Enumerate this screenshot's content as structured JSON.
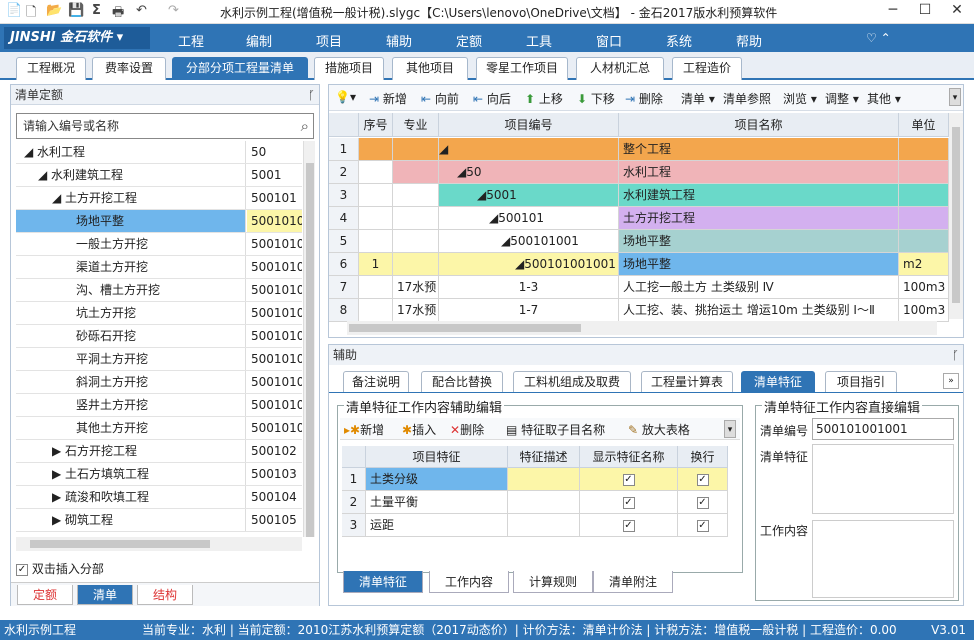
{
  "window": {
    "title": "水利示例工程(增值税一般计税).slygc【C:\\Users\\lenovo\\OneDrive\\文档】 - 金石2017版水利预算软件",
    "min": "─",
    "max": "☐",
    "close": "✕"
  },
  "menubar": {
    "logo": "JINSHI 金石软件 ▾",
    "items": [
      "工程",
      "编制",
      "项目",
      "辅助",
      "定额",
      "工具",
      "窗口",
      "系统",
      "帮助"
    ],
    "help_icon": "♡ ⌃"
  },
  "main_tabs": [
    "工程概况",
    "费率设置",
    "分部分项工程量清单",
    "措施项目",
    "其他项目",
    "零星工作项目",
    "人材机汇总",
    "工程造价"
  ],
  "left": {
    "header": "清单定额",
    "pin": "ᚵ",
    "search_placeholder": "请输入编号或名称",
    "tree": [
      {
        "name": "◢ 水利工程",
        "code": "50"
      },
      {
        "name": "◢ 水利建筑工程",
        "code": "5001"
      },
      {
        "name": "◢ 土方开挖工程",
        "code": "500101"
      },
      {
        "name": "场地平整",
        "code": "5001010"
      },
      {
        "name": "一般土方开挖",
        "code": "5001010"
      },
      {
        "name": "渠道土方开挖",
        "code": "5001010"
      },
      {
        "name": "沟、槽土方开挖",
        "code": "5001010"
      },
      {
        "name": "坑土方开挖",
        "code": "5001010"
      },
      {
        "name": "砂砾石开挖",
        "code": "5001010"
      },
      {
        "name": "平洞土方开挖",
        "code": "5001010"
      },
      {
        "name": "斜洞土方开挖",
        "code": "5001010"
      },
      {
        "name": "竖井土方开挖",
        "code": "5001010"
      },
      {
        "name": "其他土方开挖",
        "code": "5001010"
      },
      {
        "name": "▶ 石方开挖工程",
        "code": "500102"
      },
      {
        "name": "▶ 土石方填筑工程",
        "code": "500103"
      },
      {
        "name": "▶ 疏浚和吹填工程",
        "code": "500104"
      },
      {
        "name": "▶ 砌筑工程",
        "code": "500105"
      }
    ],
    "checkbox_label": "双击插入分部",
    "bottom_tabs": [
      "定额",
      "清单",
      "结构"
    ]
  },
  "toolbar": [
    "新增",
    "向前",
    "向后",
    "上移",
    "下移",
    "删除",
    "清单 ▾",
    "清单参照",
    "浏览 ▾",
    "调整 ▾",
    "其他 ▾"
  ],
  "grid": {
    "headers": [
      "",
      "序号",
      "专业",
      "项目编号",
      "项目名称",
      "单位"
    ],
    "rows": [
      {
        "no": "1",
        "seq": "",
        "major": "",
        "code": "◢",
        "name": "整个工程",
        "unit": ""
      },
      {
        "no": "2",
        "seq": "",
        "major": "",
        "code": "◢50",
        "name": "水利工程",
        "unit": ""
      },
      {
        "no": "3",
        "seq": "",
        "major": "",
        "code": "◢5001",
        "name": "水利建筑工程",
        "unit": ""
      },
      {
        "no": "4",
        "seq": "",
        "major": "",
        "code": "◢500101",
        "name": "土方开挖工程",
        "unit": ""
      },
      {
        "no": "5",
        "seq": "",
        "major": "",
        "code": "◢500101001",
        "name": "场地平整",
        "unit": ""
      },
      {
        "no": "6",
        "seq": "1",
        "major": "",
        "code": "◢500101001001",
        "name": "场地平整",
        "unit": "m2"
      },
      {
        "no": "7",
        "seq": "",
        "major": "17水预",
        "code": "1-3",
        "name": "人工挖一般土方 土类级别 Ⅳ",
        "unit": "100m3"
      },
      {
        "no": "8",
        "seq": "",
        "major": "17水预",
        "code": "1-7",
        "name": "人工挖、装、挑抬运土 增运10m 土类级别 Ⅰ～Ⅱ",
        "unit": "100m3"
      }
    ]
  },
  "aux": {
    "header": "辅助",
    "tabs": [
      "备注说明",
      "配合比替换",
      "工料机组成及取费",
      "工程量计算表",
      "清单特征",
      "项目指引"
    ],
    "group1_title": "清单特征工作内容辅助编辑",
    "group1_tools": [
      "新增",
      "插入",
      "删除",
      "特征取子目名称",
      "放大表格"
    ],
    "feature_headers": [
      "",
      "项目特征",
      "特征描述",
      "显示特征名称",
      "换行"
    ],
    "features": [
      {
        "no": "1",
        "name": "土类分级",
        "desc": "",
        "show": "✓",
        "wrap": "✓"
      },
      {
        "no": "2",
        "name": "土量平衡",
        "desc": "",
        "show": "✓",
        "wrap": "✓"
      },
      {
        "no": "3",
        "name": "运距",
        "desc": "",
        "show": "✓",
        "wrap": "✓"
      }
    ],
    "group2_title": "清单特征工作内容直接编辑",
    "list_code_label": "清单编号",
    "list_code_value": "500101001001",
    "list_feature_label": "清单特征",
    "work_content_label": "工作内容",
    "footer_tabs": [
      "清单特征",
      "工作内容",
      "计算规则",
      "清单附注"
    ]
  },
  "status": {
    "project": "水利示例工程",
    "info": "当前专业：水利 | 当前定额：2010江苏水利预算定额（2017动态价）| 计价方法：清单计价法 | 计税方法：增值税一般计税 | 工程造价：0.00",
    "version": "V3.01"
  }
}
